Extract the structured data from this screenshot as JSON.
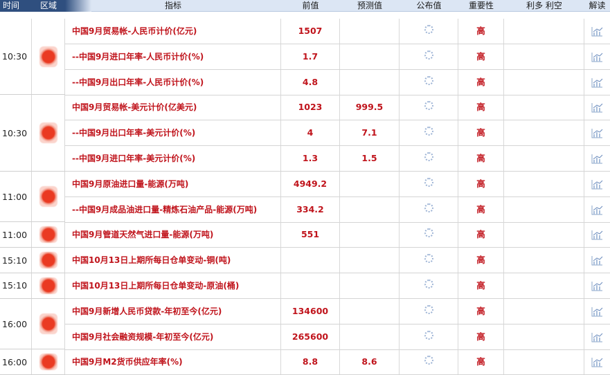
{
  "header": {
    "time": "时间",
    "region": "区域",
    "indicator": "指标",
    "previous": "前值",
    "forecast": "预测值",
    "published": "公布值",
    "importance": "重要性",
    "long_short": "利多 利空",
    "interpret": "解读"
  },
  "groups": [
    {
      "time": "10:30",
      "rows": 3
    },
    {
      "time": "10:30",
      "rows": 3
    },
    {
      "time": "11:00",
      "rows": 2
    },
    {
      "time": "11:00",
      "rows": 1
    },
    {
      "time": "15:10",
      "rows": 1
    },
    {
      "time": "15:10",
      "rows": 1
    },
    {
      "time": "16:00",
      "rows": 2
    },
    {
      "time": "16:00",
      "rows": 1
    }
  ],
  "rows": [
    {
      "indicator": "中国9月贸易帐-人民币计价(亿元)",
      "previous": "1507",
      "forecast": "",
      "importance": "高"
    },
    {
      "indicator": "--中国9月进口年率-人民币计价(%)",
      "previous": "1.7",
      "forecast": "",
      "importance": "高"
    },
    {
      "indicator": "--中国9月出口年率-人民币计价(%)",
      "previous": "4.8",
      "forecast": "",
      "importance": "高"
    },
    {
      "indicator": "中国9月贸易帐-美元计价(亿美元)",
      "previous": "1023",
      "forecast": "999.5",
      "importance": "高"
    },
    {
      "indicator": "--中国9月出口年率-美元计价(%)",
      "previous": "4",
      "forecast": "7.1",
      "importance": "高"
    },
    {
      "indicator": "--中国9月进口年率-美元计价(%)",
      "previous": "1.3",
      "forecast": "1.5",
      "importance": "高"
    },
    {
      "indicator": "中国9月原油进口量-能源(万吨)",
      "previous": "4949.2",
      "forecast": "",
      "importance": "高"
    },
    {
      "indicator": "--中国9月成品油进口量-精炼石油产品-能源(万吨)",
      "previous": "334.2",
      "forecast": "",
      "importance": "高"
    },
    {
      "indicator": "中国9月管道天然气进口量-能源(万吨)",
      "previous": "551",
      "forecast": "",
      "importance": "高"
    },
    {
      "indicator": "中国10月13日上期所每日仓单变动-铜(吨)",
      "previous": "",
      "forecast": "",
      "importance": "高"
    },
    {
      "indicator": "中国10月13日上期所每日仓单变动-原油(桶)",
      "previous": "",
      "forecast": "",
      "importance": "高"
    },
    {
      "indicator": "中国9月新增人民币贷款-年初至今(亿元)",
      "previous": "134600",
      "forecast": "",
      "importance": "高"
    },
    {
      "indicator": "中国9月社会融资规模-年初至今(亿元)",
      "previous": "265600",
      "forecast": "",
      "importance": "高"
    },
    {
      "indicator": "中国9月M2货币供应年率(%)",
      "previous": "8.8",
      "forecast": "8.6",
      "importance": "高"
    }
  ],
  "icons": {
    "published_pending": "loading-spinner-icon",
    "interpret": "chart-icon",
    "region": "country-flag-icon"
  },
  "colors": {
    "value_red": "#c0141c",
    "header_bg": "#dce6f4",
    "header_dark": "#2f4f7f"
  }
}
